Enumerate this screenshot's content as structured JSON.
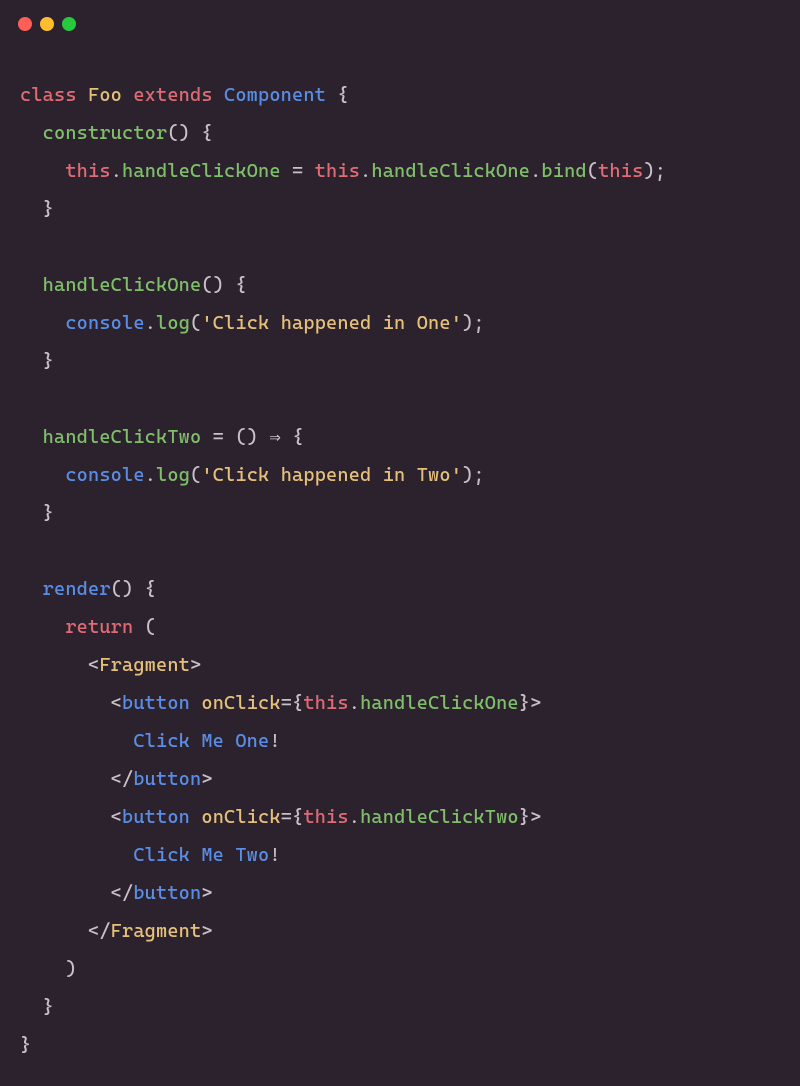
{
  "titlebar": {
    "red_label": "close",
    "yellow_label": "minimize",
    "green_label": "zoom"
  },
  "code": {
    "line01": {
      "a": "class ",
      "b": "Foo ",
      "c": "extends ",
      "d": "Component ",
      "e": "{"
    },
    "line02": {
      "a": "  ",
      "b": "constructor",
      "c": "() {"
    },
    "line03": {
      "a": "    ",
      "b": "this",
      "c": ".",
      "d": "handleClickOne",
      "e": " = ",
      "f": "this",
      "g": ".",
      "h": "handleClickOne",
      "i": ".",
      "j": "bind",
      "k": "(",
      "l": "this",
      "m": ");"
    },
    "line04": {
      "a": "  }"
    },
    "line05": {
      "a": ""
    },
    "line06": {
      "a": "  ",
      "b": "handleClickOne",
      "c": "() {"
    },
    "line07": {
      "a": "    ",
      "b": "console",
      "c": ".",
      "d": "log",
      "e": "(",
      "f": "'Click happened in One'",
      "g": ");"
    },
    "line08": {
      "a": "  }"
    },
    "line09": {
      "a": ""
    },
    "line10": {
      "a": "  ",
      "b": "handleClickTwo",
      "c": " = () ",
      "d": "⇒",
      "e": " {"
    },
    "line11": {
      "a": "    ",
      "b": "console",
      "c": ".",
      "d": "log",
      "e": "(",
      "f": "'Click happened in Two'",
      "g": ");"
    },
    "line12": {
      "a": "  }"
    },
    "line13": {
      "a": ""
    },
    "line14": {
      "a": "  ",
      "b": "render",
      "c": "() {"
    },
    "line15": {
      "a": "    ",
      "b": "return",
      "c": " ("
    },
    "line16": {
      "a": "      ",
      "b": "<",
      "c": "Fragment",
      "d": ">"
    },
    "line17": {
      "a": "        ",
      "b": "<",
      "c": "button ",
      "d": "onClick",
      "e": "=",
      "f": "{",
      "g": "this",
      "h": ".",
      "i": "handleClickOne",
      "j": "}",
      "k": ">"
    },
    "line18": {
      "a": "          ",
      "b": "Click Me One",
      "c": "!"
    },
    "line19": {
      "a": "        ",
      "b": "</",
      "c": "button",
      "d": ">"
    },
    "line20": {
      "a": "        ",
      "b": "<",
      "c": "button ",
      "d": "onClick",
      "e": "=",
      "f": "{",
      "g": "this",
      "h": ".",
      "i": "handleClickTwo",
      "j": "}",
      "k": ">"
    },
    "line21": {
      "a": "          ",
      "b": "Click Me Two",
      "c": "!"
    },
    "line22": {
      "a": "        ",
      "b": "</",
      "c": "button",
      "d": ">"
    },
    "line23": {
      "a": "      ",
      "b": "</",
      "c": "Fragment",
      "d": ">"
    },
    "line24": {
      "a": "    )"
    },
    "line25": {
      "a": "  }"
    },
    "line26": {
      "a": "}"
    }
  }
}
